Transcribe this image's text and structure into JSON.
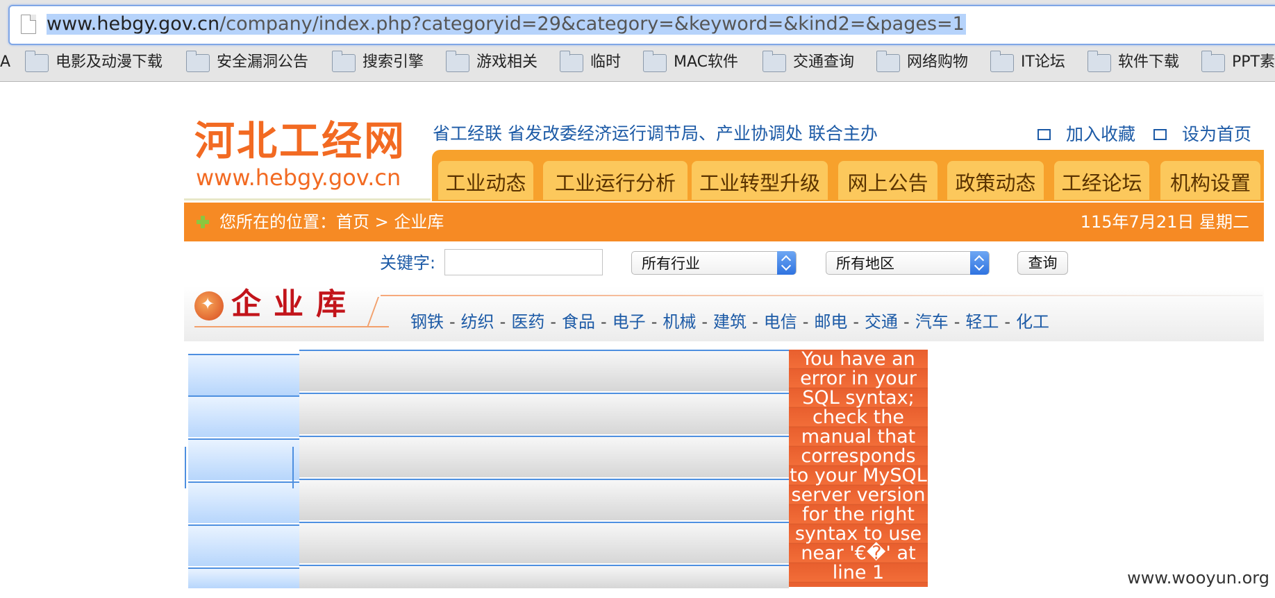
{
  "browser": {
    "url_host": "www.hebgy.gov.cn",
    "url_rest": "/company/index.php?categoryid=29&category=&keyword=&kind2=&pages=1",
    "bookmark_edge": "A",
    "bookmarks": [
      "电影及动漫下载",
      "安全漏洞公告",
      "搜索引擎",
      "游戏相关",
      "临时",
      "MAC软件",
      "交通查询",
      "网络购物",
      "IT论坛",
      "软件下载",
      "PPT素"
    ]
  },
  "site": {
    "logo_cn": "河北工经网",
    "logo_en": "www.hebgy.gov.cn",
    "sponsor": "省工经联 省发改委经济运行调节局、产业协调处 联合主办",
    "add_favorite": "加入收藏",
    "set_home": "设为首页",
    "nav": [
      "工业动态",
      "工业运行分析",
      "工业转型升级",
      "网上公告",
      "政策动态",
      "工经论坛",
      "机构设置"
    ]
  },
  "breadcrumb": {
    "text": "您所在的位置：首页 > 企业库",
    "date": "115年7月21日 星期二"
  },
  "search": {
    "keyword_label": "关键字:",
    "keyword_value": "",
    "industry_selected": "所有行业",
    "region_selected": "所有地区",
    "query_label": "查询"
  },
  "library": {
    "title": "企业库",
    "industries": [
      "钢铁",
      "纺织",
      "医药",
      "食品",
      "电子",
      "机械",
      "建筑",
      "电信",
      "邮电",
      "交通",
      "汽车",
      "轻工",
      "化工"
    ]
  },
  "error": {
    "message": "You have an error in your SQL syntax; check the manual that corresponds to your MySQL server version for the right syntax to use near '€�' at line 1"
  },
  "watermark": "www.wooyun.org",
  "colors": {
    "accent_orange": "#f68a24",
    "logo_orange": "#f26a22",
    "link_blue": "#1c5aa6",
    "error_red": "#e85f2e"
  }
}
